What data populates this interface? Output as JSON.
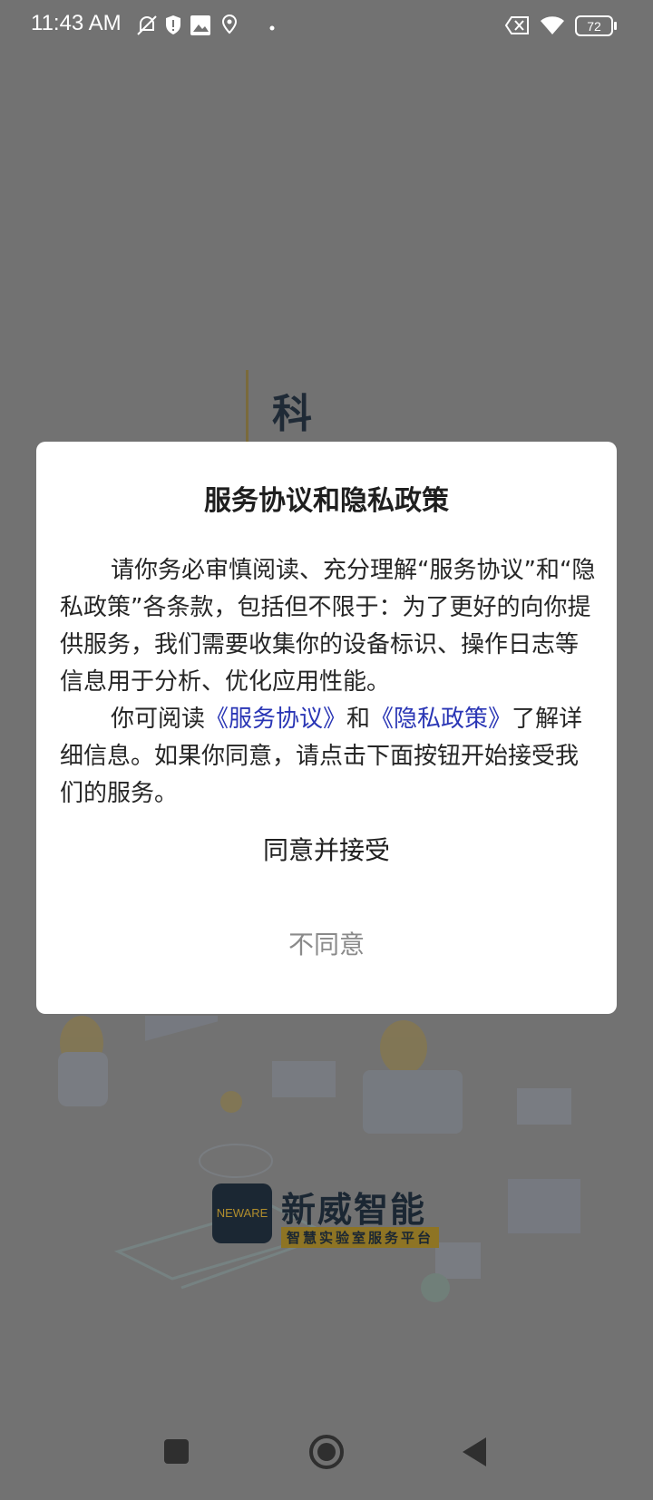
{
  "status_bar": {
    "time": "11:43 AM",
    "battery": "72",
    "icons": [
      "mute-icon",
      "shield-icon",
      "image-icon",
      "location-icon",
      "dot-icon",
      "sim-off-icon",
      "wifi-icon",
      "battery-icon"
    ]
  },
  "splash": {
    "title_char": "科",
    "brand_logo_text": "NEWARE",
    "brand_name": "新威智能",
    "brand_tagline": "智慧实验室服务平台"
  },
  "dialog": {
    "title": "服务协议和隐私政策",
    "para1": "请你务必审慎阅读、充分理解“服务协议”和“隐私政策”各条款，包括但不限于：为了更好的向你提供服务，我们需要收集你的设备标识、操作日志等信息用于分析、优化应用性能。",
    "para2_prefix": "你可阅读",
    "link_service": "《服务协议》",
    "para2_and": "和",
    "link_privacy": "《隐私政策》",
    "para2_suffix": "了解详细信息。如果你同意，请点击下面按钮开始接受我们的服务。",
    "agree_label": "同意并接受",
    "disagree_label": "不同意"
  },
  "colors": {
    "scrim_background": "#727272",
    "link": "#2a36b5",
    "disagree_text": "#8a8a8a"
  },
  "nav_bar": {
    "buttons": [
      "recents-button",
      "home-button",
      "back-button"
    ]
  }
}
